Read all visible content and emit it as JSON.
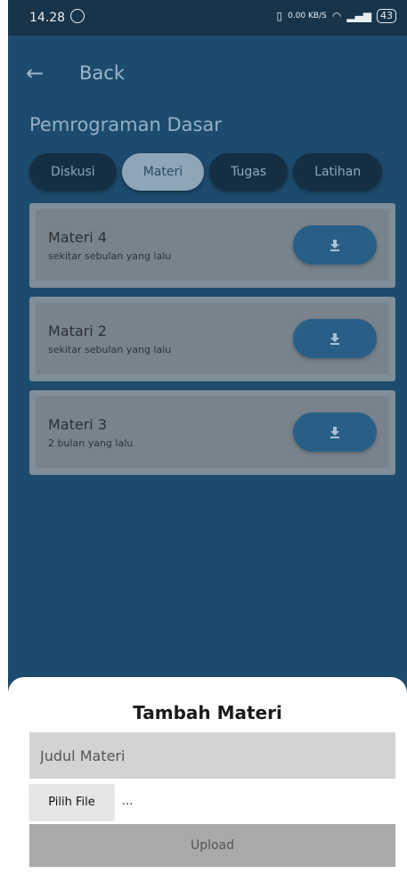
{
  "status_bar": {
    "time": "14.28",
    "network_speed": "0.00 KB/S",
    "battery": "43"
  },
  "appbar": {
    "back_label": "Back"
  },
  "course": {
    "title": "Pemrograman Dasar"
  },
  "tabs": [
    {
      "label": "Diskusi",
      "active": false
    },
    {
      "label": "Materi",
      "active": true
    },
    {
      "label": "Tugas",
      "active": false
    },
    {
      "label": "Latihan",
      "active": false
    }
  ],
  "materials": [
    {
      "title": "Materi 4",
      "subtitle": "sekitar sebulan yang lalu"
    },
    {
      "title": "Matari 2",
      "subtitle": "sekitar sebulan yang lalu"
    },
    {
      "title": "Materi 3",
      "subtitle": "2 bulan yang lalu"
    }
  ],
  "sheet": {
    "title": "Tambah Materi",
    "title_placeholder": "Judul Materi",
    "pick_file_label": "Pilih File",
    "file_name": "...",
    "upload_label": "Upload"
  },
  "colors": {
    "background": "#1d4b6d",
    "status_bar": "#17344a",
    "tab_inactive": "#142f44",
    "tab_active": "#8fa6b8",
    "card": "#7f8e99",
    "download_button": "#295f86",
    "sheet": "#ffffff"
  },
  "icons": {
    "back": "arrow-left-icon",
    "download": "download-icon",
    "whatsapp": "whatsapp-icon",
    "wifi": "wifi-icon",
    "signal": "signal-icon",
    "battery": "battery-icon"
  }
}
